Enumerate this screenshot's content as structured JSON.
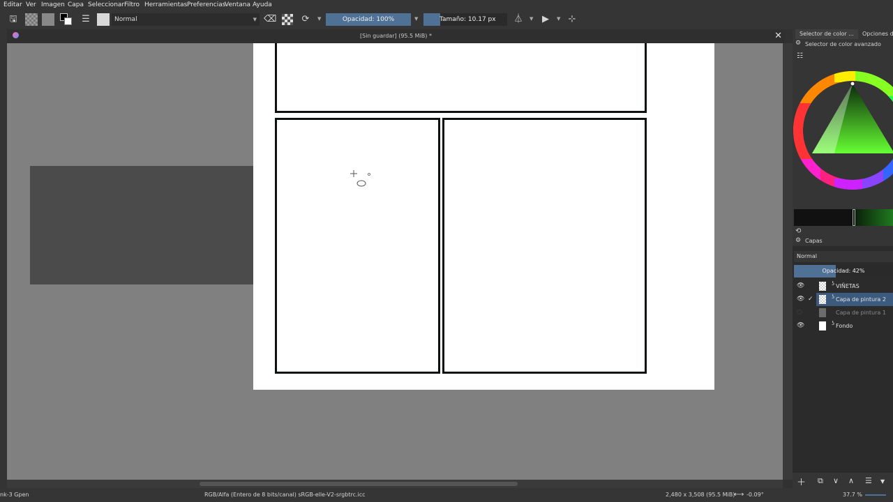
{
  "menu": [
    "Editar",
    "Ver",
    "Imagen",
    "Capa",
    "Seleccionar",
    "Filtro",
    "Herramientas",
    "Preferencias",
    "Ventana",
    "Ayuda"
  ],
  "toolbar": {
    "blend_mode": "Normal",
    "opacity": "Opacidad: 100%",
    "opacity_value": 1.0,
    "size": "Tamaño: 10.17 px"
  },
  "document": {
    "title": "[Sin guardar]  (95.5 MiB) *",
    "close": "✕"
  },
  "dock": {
    "tab1": "Selector de color ...",
    "tab2": "Opciones de",
    "color_selector_title": "Selector de color avanzado",
    "layers_title": "Capas",
    "layer_blend": "Normal",
    "layer_opacity": "Opacidad:  42%",
    "layer_opacity_value": 0.42
  },
  "layers": [
    {
      "name": "VIÑETAS",
      "visible": true,
      "selected": false,
      "thumb": "checker",
      "icon": "link"
    },
    {
      "name": "Capa de pintura 2",
      "visible": true,
      "selected": true,
      "thumb": "checker",
      "icon": "link"
    },
    {
      "name": "Capa de pintura 1",
      "visible": false,
      "selected": false,
      "thumb": "gray",
      "icon": ""
    },
    {
      "name": "Fondo",
      "visible": true,
      "selected": false,
      "thumb": "white",
      "icon": "link"
    }
  ],
  "status": {
    "brush": "nk-3 Gpen",
    "color_space": "RGB/Alfa (Entero de 8 bits/canal)  sRGB-elle-V2-srgbtrc.icc",
    "dimensions": "2,480 x 3,508 (95.5 MiB)",
    "rotation": "-0.09°",
    "zoom": "37.7 %"
  },
  "colors": {
    "accent": "#4f7196",
    "selected_layer": "#3b5a7d",
    "canvas_bg": "#808080"
  }
}
